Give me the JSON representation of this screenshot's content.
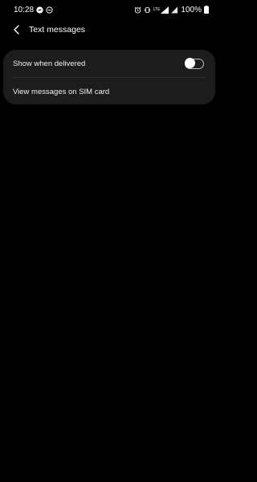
{
  "status_bar": {
    "time": "10:28",
    "battery": "100%",
    "network_label": "LTE"
  },
  "header": {
    "title": "Text messages"
  },
  "settings": {
    "items": [
      {
        "label": "Show when delivered",
        "toggle_on": false
      },
      {
        "label": "View messages on SIM card"
      }
    ]
  },
  "colors": {
    "background": "#000000",
    "card": "#1c1c1c",
    "text": "#ffffff",
    "toggle_border": "#bdbdbd"
  }
}
